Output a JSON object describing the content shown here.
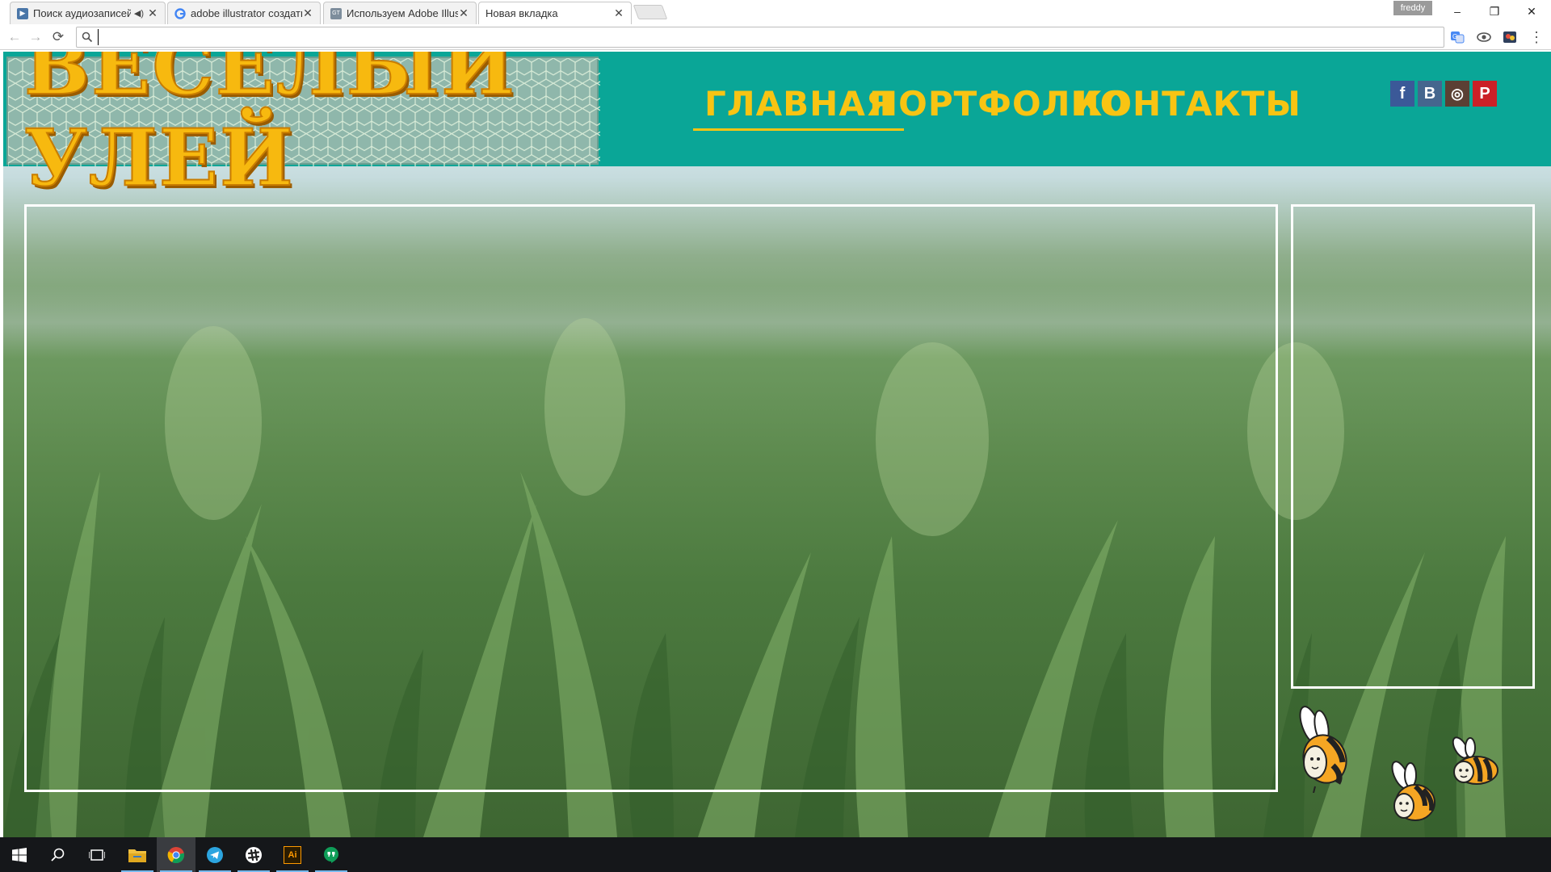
{
  "browser": {
    "tabs": [
      {
        "title": "Поиск аудиозаписей",
        "favicon": "vk-audio-icon",
        "muted_icon": "speaker-icon"
      },
      {
        "title": "adobe illustrator создать",
        "favicon": "google-icon"
      },
      {
        "title": "Используем Adobe Illustr",
        "favicon": "site-icon"
      },
      {
        "title": "Новая вкладка",
        "favicon": null
      }
    ],
    "profile_name": "freddy",
    "window_controls": {
      "minimize": "–",
      "restore": "❐",
      "close": "✕"
    },
    "toolbar": {
      "back": "←",
      "forward": "→",
      "reload": "⟳",
      "menu": "⋮"
    },
    "address_bar": {
      "value": "",
      "placeholder": ""
    }
  },
  "site": {
    "logo_text": "ВЕСЕЛЫЙ УЛЕЙ",
    "nav": [
      {
        "label": "ГЛАВНАЯ",
        "active": true
      },
      {
        "label": "ПОРТФОЛИО",
        "active": false
      },
      {
        "label": "КОНТАКТЫ",
        "active": false
      }
    ],
    "social": [
      {
        "label": "f",
        "name": "facebook",
        "color": "#3b5998"
      },
      {
        "label": "B",
        "name": "vkontakte",
        "color": "#45668e"
      },
      {
        "label": "◎",
        "name": "instagram",
        "color": "#5b4034"
      },
      {
        "label": "P",
        "name": "pinterest",
        "color": "#cb2027"
      }
    ],
    "colors": {
      "header": "#0aa697",
      "accent": "#f8c413",
      "frame": "#ffffff"
    }
  },
  "taskbar": {
    "items": [
      {
        "name": "start",
        "icon": "windows-icon"
      },
      {
        "name": "search",
        "icon": "search-icon"
      },
      {
        "name": "task-view",
        "icon": "task-view-icon"
      },
      {
        "name": "file-explorer",
        "icon": "folder-icon"
      },
      {
        "name": "chrome",
        "icon": "chrome-icon"
      },
      {
        "name": "telegram",
        "icon": "telegram-icon"
      },
      {
        "name": "slack",
        "icon": "slack-icon"
      },
      {
        "name": "illustrator",
        "icon": "illustrator-icon",
        "label": "Ai"
      },
      {
        "name": "hangouts",
        "icon": "hangouts-icon"
      }
    ]
  }
}
